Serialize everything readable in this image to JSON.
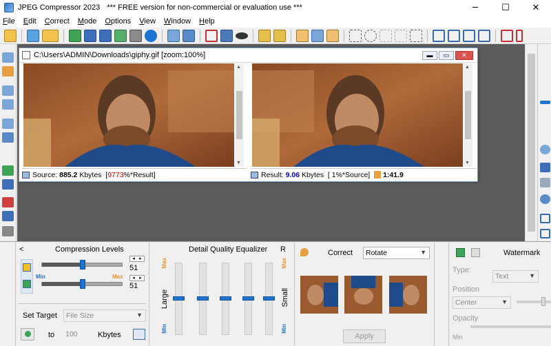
{
  "titlebar": {
    "app_name": "JPEG Compressor 2023",
    "notice": "*** FREE version for non-commercial or evaluation use ***",
    "minimize": "─",
    "maximize": "☐",
    "close": "✕"
  },
  "menu": [
    "File",
    "Edit",
    "Correct",
    "Mode",
    "Options",
    "View",
    "Window",
    "Help"
  ],
  "document": {
    "title": "C:\\Users\\ADMIN\\Downloads\\giphy.gif  [zoom:100%]",
    "source_label": "Source:",
    "source_size": "885.2",
    "source_unit": "Kbytes",
    "source_pct": "9773",
    "source_pct_suffix": "%*Result]",
    "result_label": "Result:",
    "result_size": "9.06",
    "result_unit": "Kbytes",
    "result_pct": "[ 1%*Source]",
    "ratio": "1:41.9"
  },
  "compression": {
    "title": "Compression Levels",
    "collapse": "<",
    "value1": "51",
    "value2": "51",
    "min": "Min",
    "max": "Max",
    "level1": 0.51,
    "level2": 0.51
  },
  "target": {
    "label": "Set Target",
    "mode": "File Size",
    "to": "to",
    "value": "100",
    "unit": "Kbytes"
  },
  "equalizer": {
    "title": "Detail Quality Equalizer",
    "r": "R",
    "max_left": "Max",
    "max_right": "Max",
    "min_left": "Min",
    "min_right": "Min",
    "large": "Large",
    "small": "Small"
  },
  "correct": {
    "label": "Correct",
    "mode": "Rotate",
    "apply": "Apply"
  },
  "watermark": {
    "title": "Watermark",
    "type_label": "Type:",
    "type_value": "Text",
    "position_label": "Position",
    "position_value": "Center",
    "opacity_label": "Opacity",
    "min": "Min"
  }
}
